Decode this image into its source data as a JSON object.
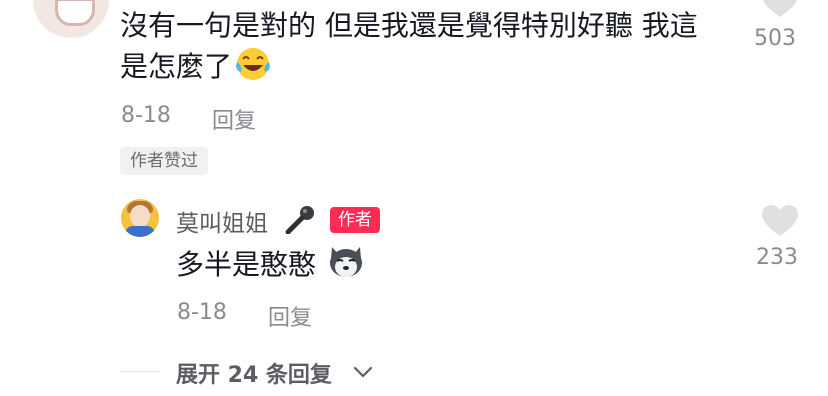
{
  "comment": {
    "text": "沒有一句是對的 但是我還是覺得特別好聽 我這是怎麼了",
    "date": "8-18",
    "reply_label": "回复",
    "author_liked_badge": "作者赞过",
    "like_count": "503",
    "emoji_icon": "laughing-tears-emoji-icon"
  },
  "reply": {
    "username": "莫叫姐姐",
    "author_tag": "作者",
    "text": "多半是憨憨",
    "date": "8-18",
    "reply_label": "回复",
    "like_count": "233",
    "name_icon": "microphone-icon",
    "emoji_icon": "husky-dog-emoji-icon"
  },
  "expand": {
    "label": "展开 24 条回复"
  },
  "colors": {
    "author_tag": "#fe2c55",
    "meta_text": "#8a8b91",
    "heart": "#e0e0e2"
  }
}
